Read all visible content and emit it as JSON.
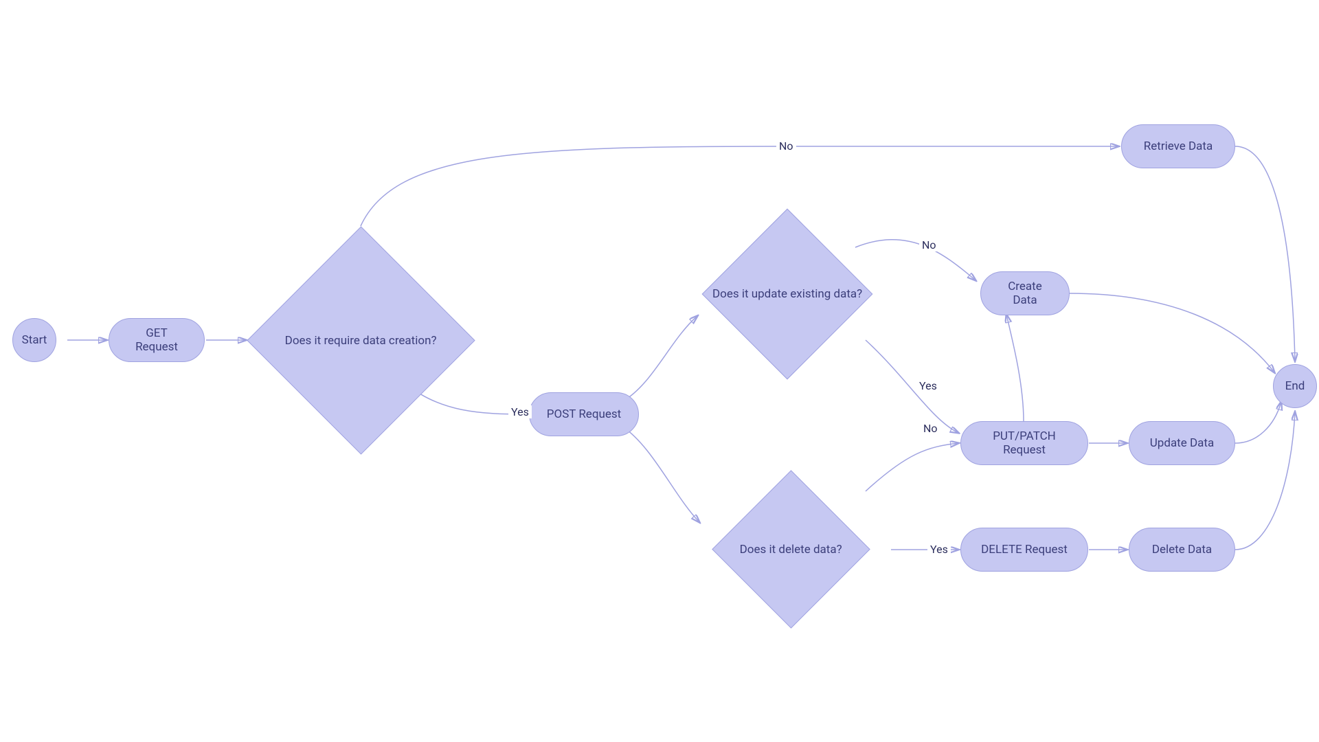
{
  "nodes": {
    "start": "Start",
    "get": "GET Request",
    "q_create": "Does it require data creation?",
    "post": "POST Request",
    "q_update": "Does it update existing data?",
    "q_delete": "Does it delete data?",
    "retrieve": "Retrieve Data",
    "create": "Create Data",
    "putpatch": "PUT/PATCH Request",
    "update": "Update Data",
    "delete_req": "DELETE Request",
    "delete_data": "Delete Data",
    "end": "End"
  },
  "labels": {
    "no1": "No",
    "yes1": "Yes",
    "no2": "No",
    "yes2": "Yes",
    "no3": "No",
    "yes3": "Yes"
  },
  "colors": {
    "node_fill": "#c6c8f2",
    "node_border": "#9fa2e0",
    "text": "#3b3e7a",
    "line": "#9fa2e0"
  }
}
